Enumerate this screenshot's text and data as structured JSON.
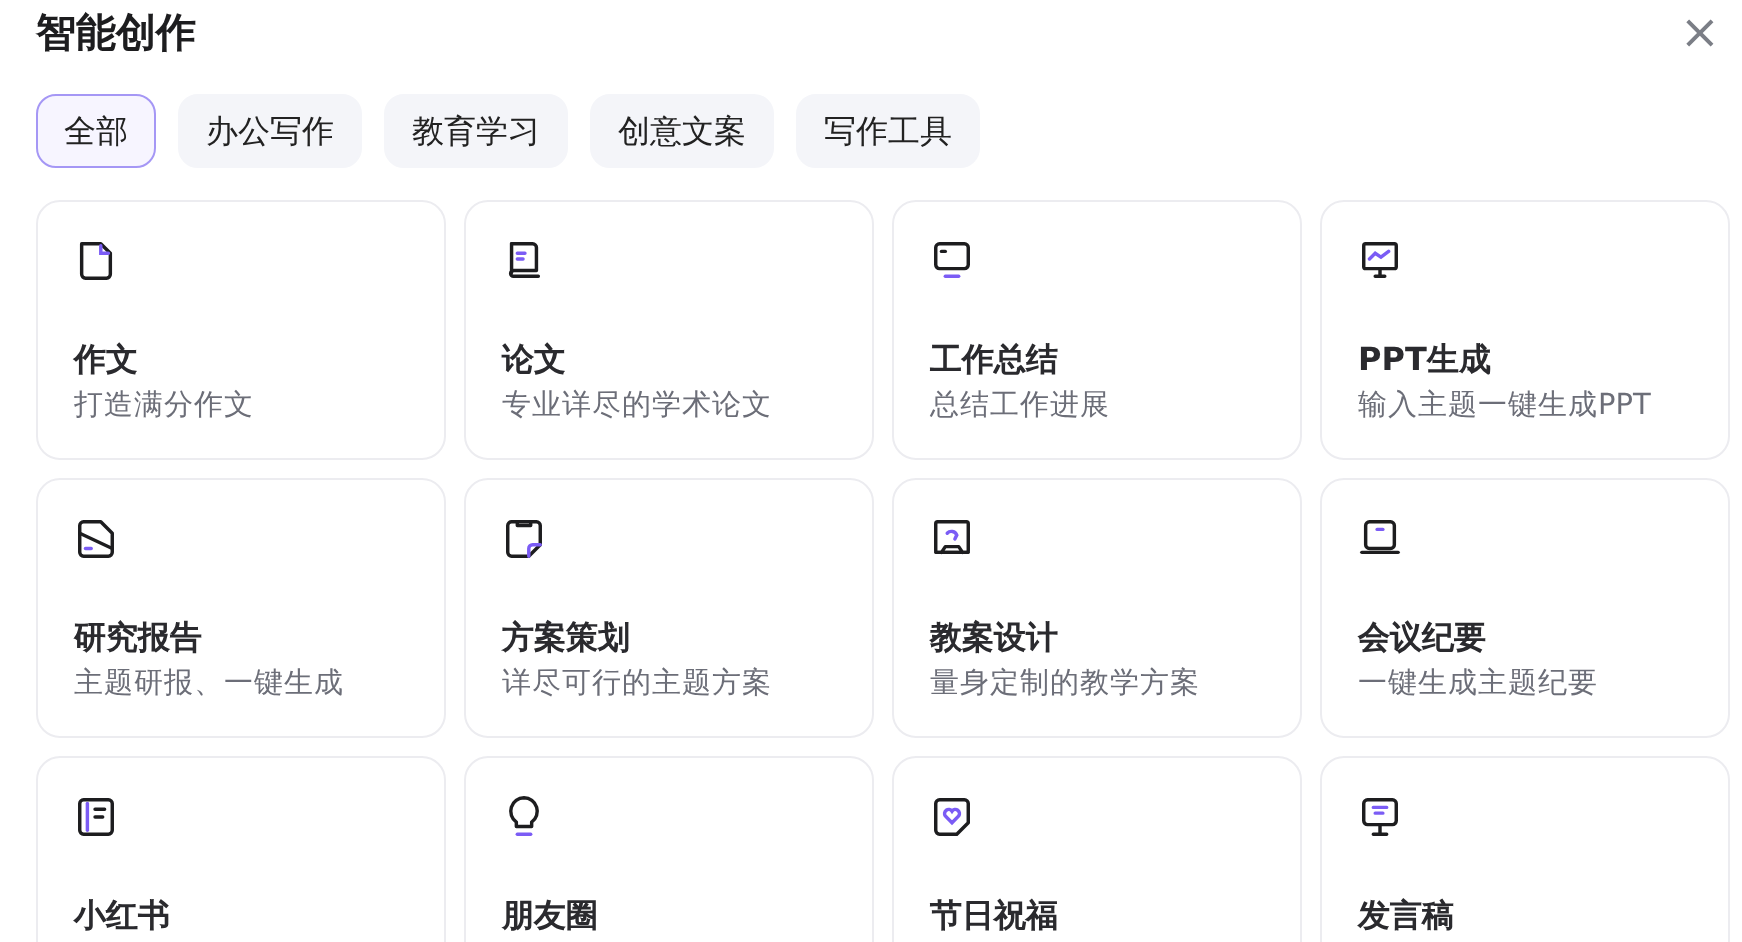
{
  "dialog": {
    "title": "智能创作",
    "close": "×"
  },
  "tabs": [
    {
      "label": "全部",
      "selected": true
    },
    {
      "label": "办公写作",
      "selected": false
    },
    {
      "label": "教育学习",
      "selected": false
    },
    {
      "label": "创意文案",
      "selected": false
    },
    {
      "label": "写作工具",
      "selected": false
    }
  ],
  "cards": [
    {
      "title": "作文",
      "description": "打造满分作文"
    },
    {
      "title": "论文",
      "description": "专业详尽的学术论文"
    },
    {
      "title": "工作总结",
      "description": "总结工作进展"
    },
    {
      "title": "PPT生成",
      "description": "输入主题一键生成PPT"
    },
    {
      "title": "研究报告",
      "description": "主题研报、一键生成"
    },
    {
      "title": "方案策划",
      "description": "详尽可行的主题方案"
    },
    {
      "title": "教案设计",
      "description": "量身定制的教学方案"
    },
    {
      "title": "会议纪要",
      "description": "一键生成主题纪要"
    },
    {
      "title": "小红书"
    },
    {
      "title": "朋友圈"
    },
    {
      "title": "节日祝福"
    },
    {
      "title": "发言稿"
    }
  ]
}
